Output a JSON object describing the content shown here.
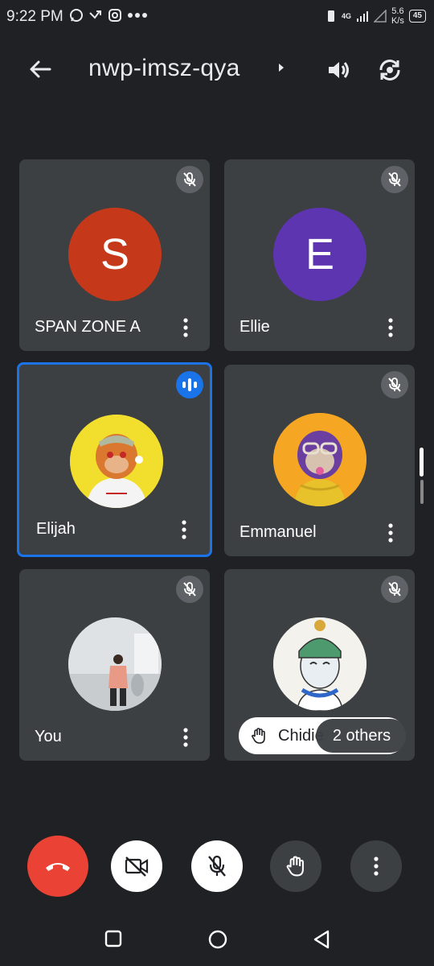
{
  "status_bar": {
    "time": "9:22 PM",
    "net_speed_value": "5.6",
    "net_speed_unit": "K/s",
    "network": "4G",
    "battery": "45"
  },
  "header": {
    "meeting_code": "nwp-imsz-qya",
    "back_icon": "arrow-left-icon",
    "speaker_icon": "speaker-icon",
    "switch_camera_icon": "switch-camera-icon"
  },
  "participants": [
    {
      "name": "SPAN ZONE A",
      "initial": "S",
      "avatar_color": "#c5391a",
      "muted": true
    },
    {
      "name": "Ellie",
      "initial": "E",
      "avatar_color": "#5e35b1",
      "muted": true
    },
    {
      "name": "Elijah",
      "initial": "",
      "muted": false,
      "speaking": true
    },
    {
      "name": "Emmanuel",
      "initial": "",
      "muted": true
    },
    {
      "name": "You",
      "initial": "",
      "muted": true
    },
    {
      "name": "Chidiebube",
      "initial": "",
      "muted": true
    }
  ],
  "overflow": {
    "visible_name": "Chidie",
    "others_label": "2 others"
  },
  "controls": {
    "end_call_icon": "end-call-icon",
    "camera_icon": "camera-off-icon",
    "mic_icon": "mic-off-icon",
    "raise_hand_icon": "raise-hand-icon",
    "more_icon": "more-vert-icon"
  },
  "colors": {
    "background": "#202124",
    "tile": "#3c4043",
    "accent": "#1a73e8",
    "end_call": "#ea4335"
  }
}
